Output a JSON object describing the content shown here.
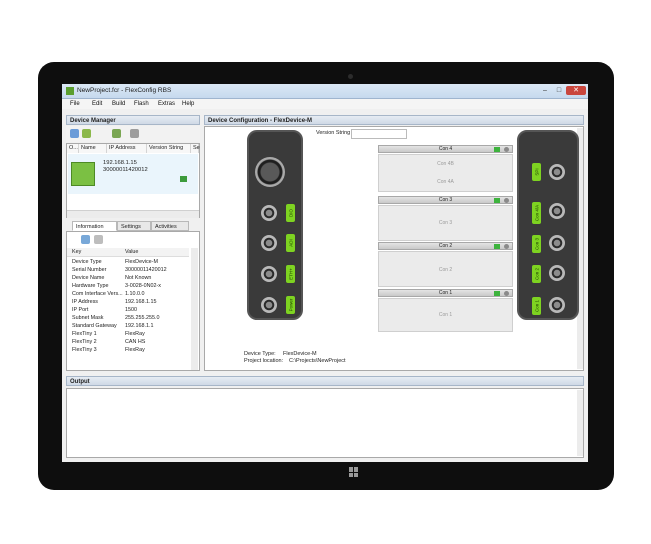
{
  "window": {
    "title": "NewProject.fcr - FlexConfig RBS",
    "min": "–",
    "max": "□",
    "close": "✕"
  },
  "menu": [
    "File",
    "Edit",
    "Build",
    "Flash",
    "Extras",
    "Help"
  ],
  "device_manager": {
    "title": "Device Manager",
    "columns": [
      "O...",
      "Name",
      "IP Address",
      "Version String",
      "Se"
    ],
    "device": {
      "ip": "192.168.1.15",
      "serial": "30000011420012"
    }
  },
  "tabs": [
    "Information",
    "Settings",
    "Activities"
  ],
  "info_table": {
    "headers": [
      "Key",
      "Value"
    ],
    "rows": [
      {
        "k": "Device Type",
        "v": "FlexDevice-M"
      },
      {
        "k": "Serial Number",
        "v": "30000011420012"
      },
      {
        "k": "Device Name",
        "v": "Not Known"
      },
      {
        "k": "Hardware Type",
        "v": "3-0028-0N02-x"
      },
      {
        "k": "Com Interface Vers...",
        "v": "1.10.0.0"
      },
      {
        "k": "IP Address",
        "v": "192.168.1.15"
      },
      {
        "k": "IP Port",
        "v": "1500"
      },
      {
        "k": "Subnet Mask",
        "v": "255.255.255.0"
      },
      {
        "k": "Standard Gateway",
        "v": "192.168.1.1"
      },
      {
        "k": "FlexTiny 1",
        "v": "FlexRay"
      },
      {
        "k": "FlexTiny 2",
        "v": "CAN HS"
      },
      {
        "k": "FlexTiny 3",
        "v": "FlexRay"
      }
    ]
  },
  "config": {
    "title": "Device Configuration - FlexDevice-M",
    "version_label": "Version String",
    "left_labels": [
      "DIO",
      "ADI",
      "ETH+",
      "Power"
    ],
    "right_labels": [
      "SPI",
      "Con 4/A",
      "Con 3",
      "Con 2",
      "Con 1"
    ],
    "connectors": [
      {
        "name": "Con 4",
        "subs": [
          "Con 4B",
          "Con 4A"
        ]
      },
      {
        "name": "Con 3",
        "subs": [
          "Con 3"
        ]
      },
      {
        "name": "Con 2",
        "subs": [
          "Con 2"
        ]
      },
      {
        "name": "Con 1",
        "subs": [
          "Con 1"
        ]
      }
    ],
    "device_type_label": "Device Type:",
    "device_type_value": "FlexDevice-M",
    "project_location_label": "Project location:",
    "project_location_value": "C:\\Projects\\NewProject"
  },
  "output": {
    "title": "Output"
  },
  "colors": {
    "accent_green": "#7ed321",
    "panel_head": "#cfd9e6"
  }
}
